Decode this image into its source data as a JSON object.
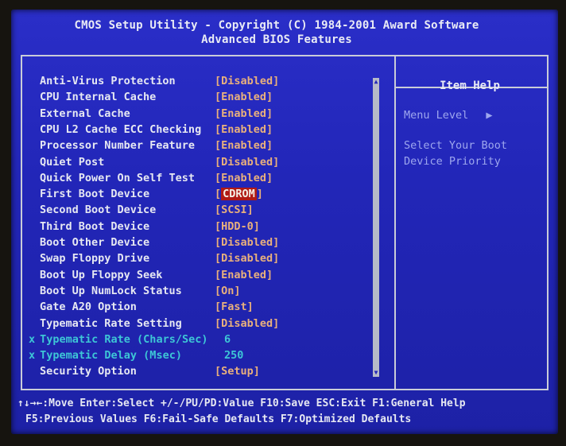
{
  "header": {
    "title_line1": "CMOS Setup Utility - Copyright (C) 1984-2001 Award Software",
    "title_line2": "Advanced BIOS Features"
  },
  "settings": [
    {
      "label": "Anti-Virus Protection",
      "value": "[Disabled]"
    },
    {
      "label": "CPU Internal Cache",
      "value": "[Enabled]"
    },
    {
      "label": "External Cache",
      "value": "[Enabled]"
    },
    {
      "label": "CPU L2 Cache ECC Checking",
      "value": "[Enabled]"
    },
    {
      "label": "Processor Number Feature",
      "value": "[Enabled]"
    },
    {
      "label": "Quiet Post",
      "value": "[Disabled]"
    },
    {
      "label": "Quick Power On Self Test",
      "value": "[Enabled]"
    },
    {
      "label": "First Boot Device",
      "value_pre": "[",
      "value": "CDROM",
      "value_post": "]",
      "selected": true
    },
    {
      "label": "Second Boot Device",
      "value": "[SCSI]"
    },
    {
      "label": "Third Boot Device",
      "value": "[HDD-0]"
    },
    {
      "label": "Boot Other Device",
      "value": "[Disabled]"
    },
    {
      "label": "Swap Floppy Drive",
      "value": "[Disabled]"
    },
    {
      "label": "Boot Up Floppy Seek",
      "value": "[Enabled]"
    },
    {
      "label": "Boot Up NumLock Status",
      "value": "[On]"
    },
    {
      "label": "Gate A20 Option",
      "value": "[Fast]"
    },
    {
      "label": "Typematic Rate Setting",
      "value": "[Disabled]"
    },
    {
      "label": "Typematic Rate (Chars/Sec)",
      "value": "6",
      "disabled": true,
      "marker": "x"
    },
    {
      "label": "Typematic Delay (Msec)",
      "value": "250",
      "disabled": true,
      "marker": "x"
    },
    {
      "label": "Security Option",
      "value": "[Setup]"
    }
  ],
  "help": {
    "title": "Item Help",
    "menu_level": "Menu Level",
    "menu_level_arrow": "▶",
    "line1": "Select Your Boot",
    "line2": "Device Priority"
  },
  "footer": {
    "line1": "↑↓→←:Move  Enter:Select  +/-/PU/PD:Value  F10:Save  ESC:Exit  F1:General Help",
    "line2": "F5:Previous Values   F6:Fail-Safe Defaults   F7:Optimized Defaults"
  },
  "colors": {
    "background": "#2226b8",
    "label": "#e6e8f2",
    "value": "#e9b07c",
    "disabled": "#3dc6d6",
    "selection": "#b01a14"
  }
}
